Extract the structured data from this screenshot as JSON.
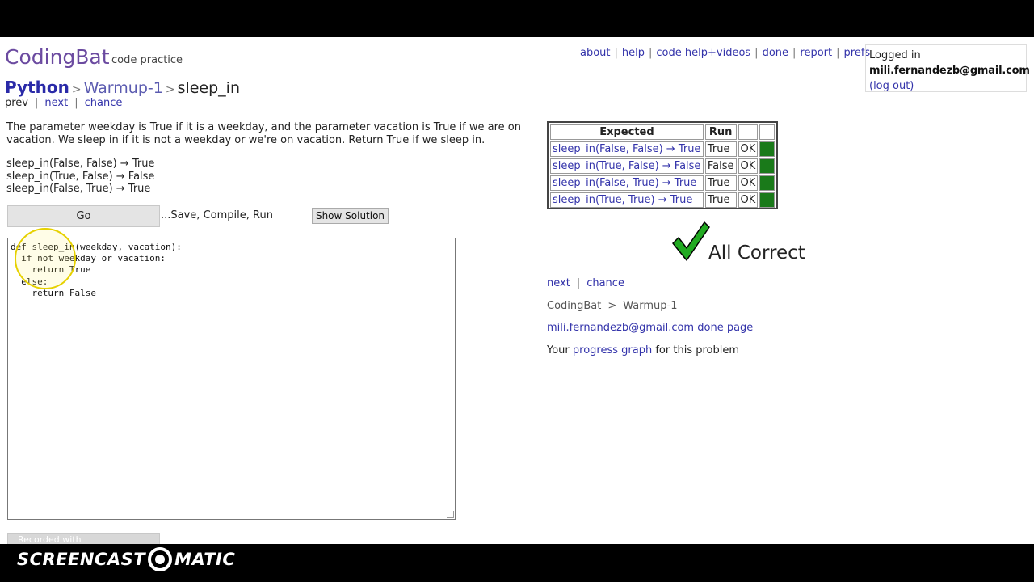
{
  "site": {
    "logo": "CodingBat",
    "tagline": "code practice"
  },
  "topnav": [
    "about",
    "help",
    "code help+videos",
    "done",
    "report",
    "prefs"
  ],
  "login": {
    "label": "Logged in",
    "email": "mili.fernandezb@gmail.com",
    "logout": "(log out)"
  },
  "breadcrumb": {
    "language": "Python",
    "section": "Warmup-1",
    "problem": "sleep_in"
  },
  "subnav": {
    "prev": "prev",
    "next": "next",
    "chance": "chance"
  },
  "problem": {
    "description": "The parameter weekday is True if it is a weekday, and the parameter vacation is True if we are on vacation. We sleep in if it is not a weekday or we're on vacation. Return True if we sleep in.",
    "examples": [
      "sleep_in(False, False) → True",
      "sleep_in(True, False) → False",
      "sleep_in(False, True) → True"
    ]
  },
  "controls": {
    "go": "Go",
    "save_hint": "...Save, Compile, Run",
    "show_solution": "Show Solution"
  },
  "editor": {
    "code": "def sleep_in(weekday, vacation):\n  if not weekday or vacation:\n    return True\n  else:\n    return False"
  },
  "results": {
    "headers": {
      "expected": "Expected",
      "run": "Run"
    },
    "rows": [
      {
        "expected": "sleep_in(False, False) → True",
        "run": "True",
        "status": "OK"
      },
      {
        "expected": "sleep_in(True, False) → False",
        "run": "False",
        "status": "OK"
      },
      {
        "expected": "sleep_in(False, True) → True",
        "run": "True",
        "status": "OK"
      },
      {
        "expected": "sleep_in(True, True) → True",
        "run": "True",
        "status": "OK"
      }
    ],
    "pass_color": "#1a7a1a"
  },
  "verdict": {
    "text": "All Correct",
    "icon": "checkmark-icon",
    "color": "#22aa22"
  },
  "after": {
    "next": "next",
    "chance": "chance",
    "crumb_home": "CodingBat",
    "crumb_gt": ">",
    "crumb_section": "Warmup-1",
    "done_email": "mili.fernandezb@gmail.com",
    "done_page": "done page",
    "progress_prefix": "Your",
    "progress_link": "progress graph",
    "progress_suffix": "for this problem"
  },
  "recorder": {
    "recorded_with": "Recorded with",
    "brand_left": "SCREENCAST",
    "brand_right": "MATIC"
  }
}
